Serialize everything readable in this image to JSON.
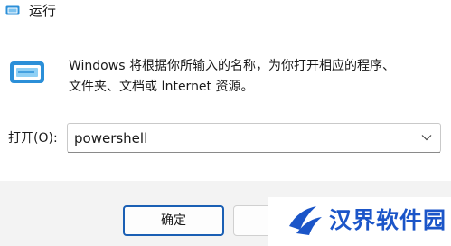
{
  "window": {
    "title": "运行"
  },
  "description": {
    "line1": "Windows 将根据你所输入的名称，为你打开相应的程序、",
    "line2": "文件夹、文档或 Internet 资源。"
  },
  "open_field": {
    "label": "打开(O):",
    "value": "powershell"
  },
  "buttons": {
    "ok_label": "确定",
    "cancel_label": ""
  },
  "watermark": {
    "text": "汉界软件园"
  },
  "icons": {
    "title": "run-icon",
    "main": "run-icon",
    "dropdown": "chevron-down-icon",
    "watermark": "logo-icon"
  },
  "colors": {
    "accent": "#1a5fb4",
    "icon_blue": "#2b8fd8",
    "watermark_blue": "#1b55c8",
    "footer_bg": "#f3f3f3"
  }
}
